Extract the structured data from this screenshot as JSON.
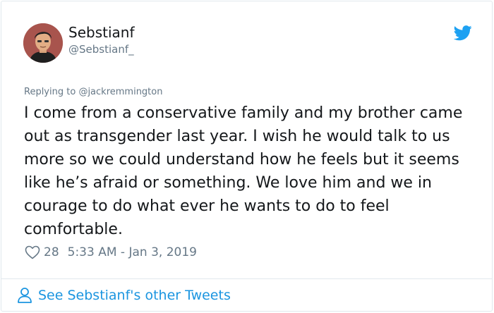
{
  "user": {
    "display_name": "Sebstianf",
    "handle": "@Sebstianf_",
    "avatar_icon": "avatar-illustration"
  },
  "brand": {
    "icon": "twitter-bird-icon",
    "color": "#1da1f2"
  },
  "reply": {
    "prefix": "Replying to",
    "mention": "@jackremmington"
  },
  "tweet": {
    "text": "I come from a conservative family and my brother came out as transgender last year. I wish he would talk to us more so we could understand how he feels but it seems like he’s afraid or something. We love him and we in courage to do what ever he wants to do to feel comfortable."
  },
  "meta": {
    "like_icon": "heart-icon",
    "likes": "28",
    "timestamp": "5:33 AM - Jan 3, 2019"
  },
  "footer": {
    "icon": "person-icon",
    "link_text": "See Sebstianf's other Tweets",
    "link_color": "#1b95e0"
  }
}
